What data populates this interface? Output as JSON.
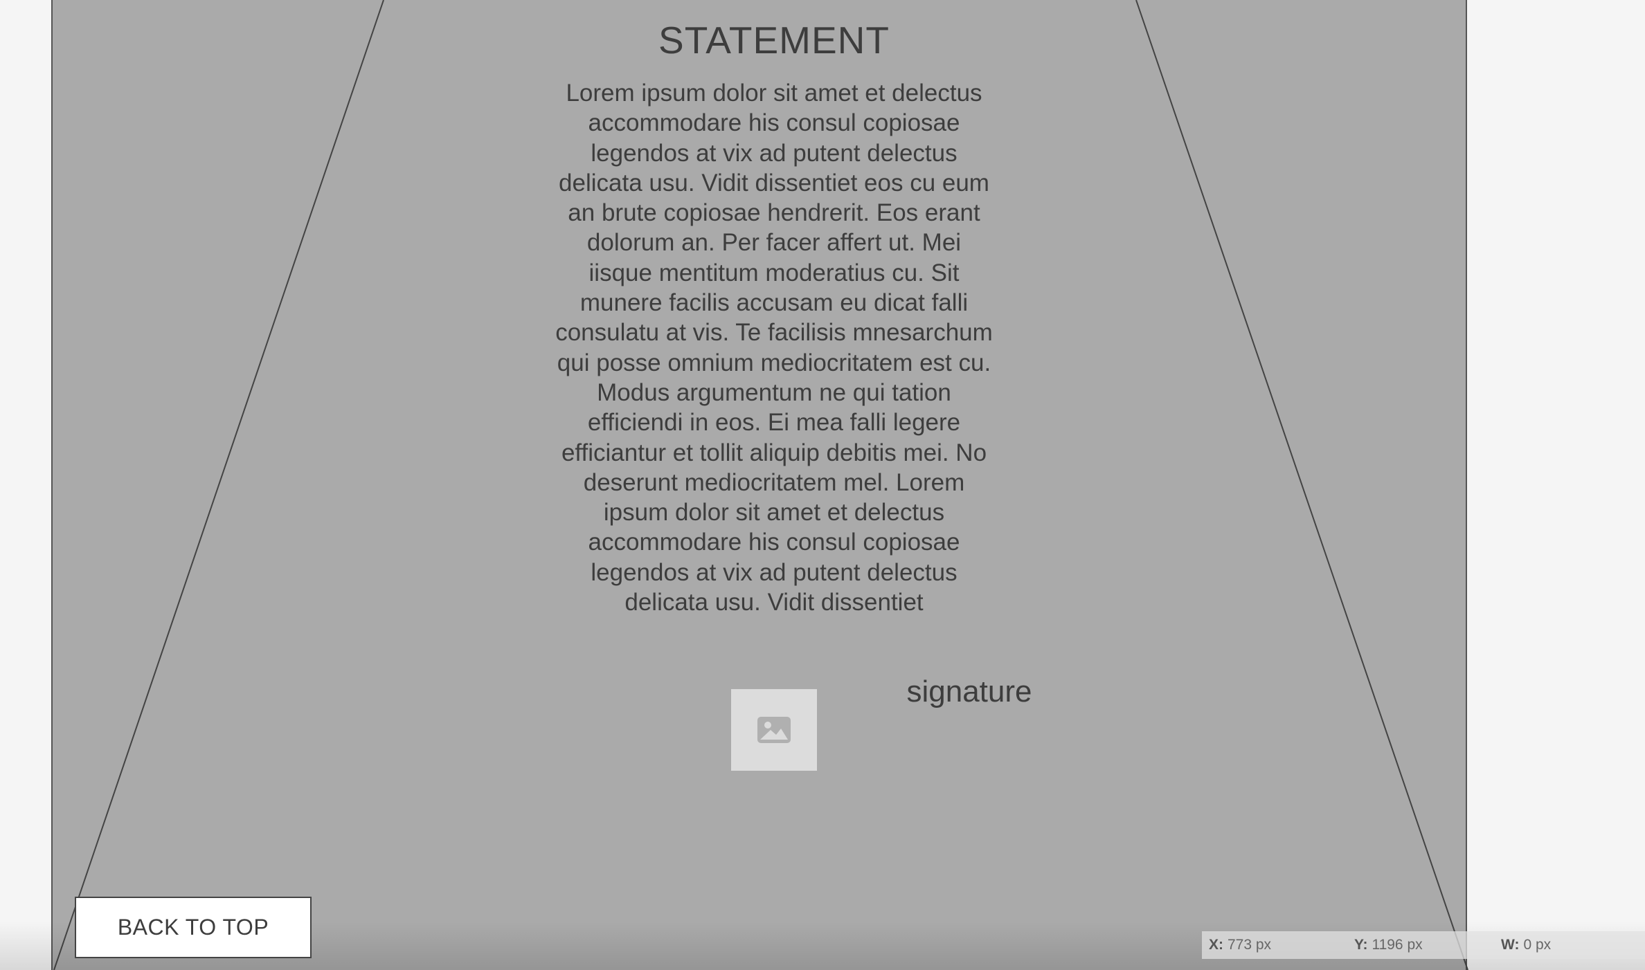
{
  "statement": {
    "title": "STATEMENT",
    "body": "Lorem ipsum dolor sit amet et delectus accommodare his consul copiosae legendos at vix ad putent delectus delicata usu. Vidit dissentiet eos cu eum an brute copiosae hendrerit. Eos erant dolorum an. Per facer affert ut. Mei iisque mentitum moderatius cu. Sit munere facilis accusam eu dicat falli consulatu at vis. Te facilisis mnesarchum qui posse omnium mediocritatem est cu. Modus argumentum ne qui tation efficiendi in eos. Ei mea falli legere efficiantur et tollit aliquip debitis mei. No deserunt mediocritatem mel. Lorem ipsum dolor sit amet et delectus accommodare his consul copiosae legendos at vix ad putent delectus delicata usu. Vidit dissentiet"
  },
  "signature": {
    "label": "signature",
    "image_icon": "image-placeholder-icon"
  },
  "buttons": {
    "back_to_top": "BACK TO TOP"
  },
  "coordinates": {
    "x_label": "X:",
    "x_value": "773 px",
    "y_label": "Y:",
    "y_value": "1196 px",
    "w_label": "W:",
    "w_value": "0 px"
  },
  "colors": {
    "page_background": "#f5f5f5",
    "panel_background": "#aaaaaa",
    "text": "#3d3d3d",
    "placeholder": "#dcdcdc"
  }
}
